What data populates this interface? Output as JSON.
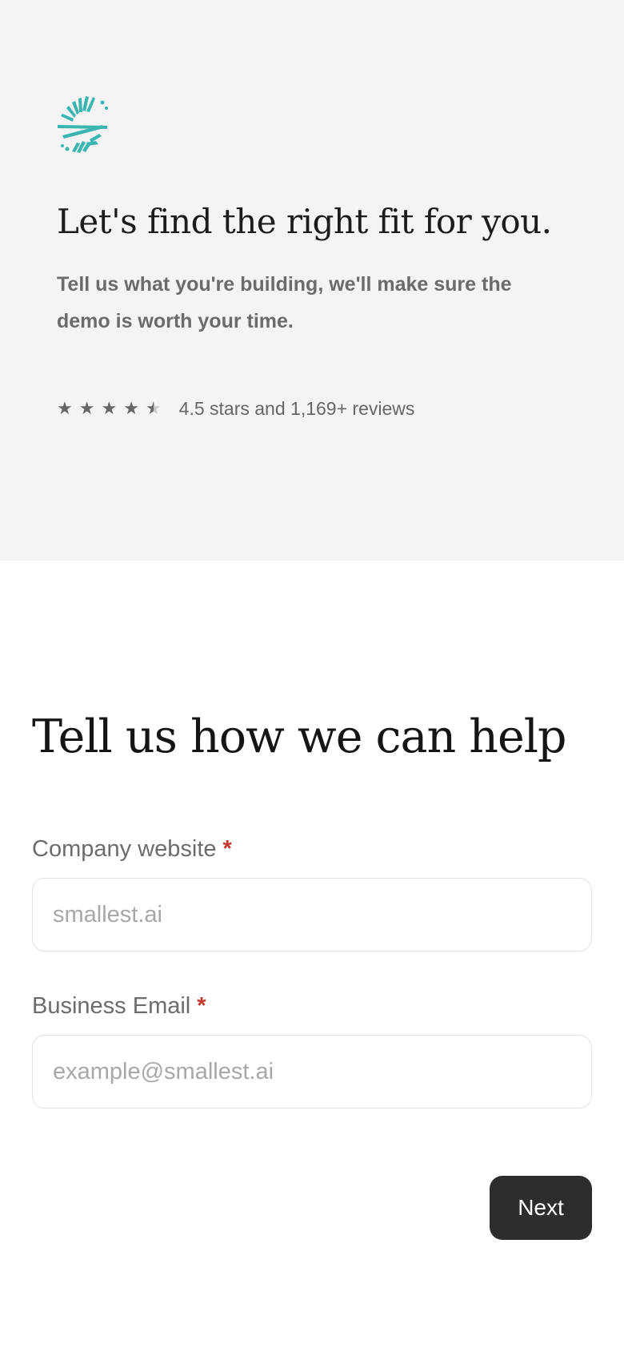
{
  "hero": {
    "title": "Let's find the right fit for you.",
    "subtitle": "Tell us what you're building, we'll make sure the demo is worth your time.",
    "rating": {
      "value": 4.5,
      "max": 5,
      "text": "4.5 stars and 1,169+ reviews"
    }
  },
  "form": {
    "title": "Tell us how we can help",
    "company_website": {
      "label": "Company website",
      "required_mark": "*",
      "placeholder": "smallest.ai",
      "value": ""
    },
    "business_email": {
      "label": "Business Email",
      "required_mark": "*",
      "placeholder": "example@smallest.ai",
      "value": ""
    },
    "next_label": "Next"
  },
  "colors": {
    "brand": "#3ab5b0",
    "button": "#2d2d2d",
    "required": "#c0392b",
    "hero_bg": "#f4f4f4"
  },
  "icons": {
    "logo": "smallest-ai-logo",
    "star": "star-icon",
    "half_star": "half-star-icon"
  }
}
